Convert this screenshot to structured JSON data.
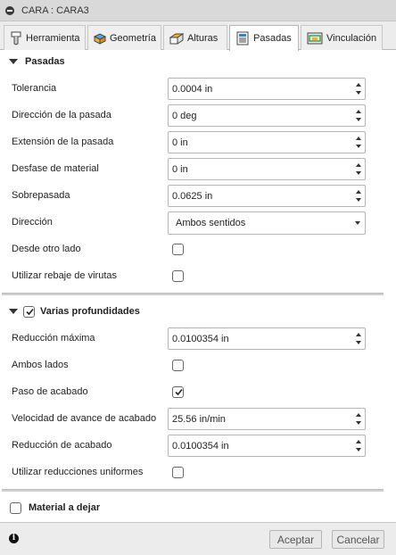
{
  "window": {
    "title": "CARA : CARA3"
  },
  "tabs": [
    {
      "label": "Herramienta",
      "icon": "tool-icon",
      "active": false
    },
    {
      "label": "Geometría",
      "icon": "geometry-icon",
      "active": false
    },
    {
      "label": "Alturas",
      "icon": "heights-icon",
      "active": false
    },
    {
      "label": "Pasadas",
      "icon": "passes-icon",
      "active": true
    },
    {
      "label": "Vinculación",
      "icon": "linking-icon",
      "active": false
    }
  ],
  "pasadas": {
    "title": "Pasadas",
    "tolerancia": {
      "label": "Tolerancia",
      "value": "0.0004 in"
    },
    "direccion_pasada": {
      "label": "Dirección de la pasada",
      "value": "0 deg"
    },
    "extension_pasada": {
      "label": "Extensión de la pasada",
      "value": "0 in"
    },
    "desfase_material": {
      "label": "Desfase de material",
      "value": "0 in"
    },
    "sobrepasada": {
      "label": "Sobrepasada",
      "value": "0.0625 in"
    },
    "direccion": {
      "label": "Dirección",
      "value": "Ambos sentidos"
    },
    "desde_otro_lado": {
      "label": "Desde otro lado",
      "checked": false
    },
    "rebaje_virutas": {
      "label": "Utilizar rebaje de virutas",
      "checked": false
    }
  },
  "varias": {
    "title": "Varias profundidades",
    "checked": true,
    "reduccion_maxima": {
      "label": "Reducción máxima",
      "value": "0.0100354 in"
    },
    "ambos_lados": {
      "label": "Ambos lados",
      "checked": false
    },
    "paso_acabado": {
      "label": "Paso de acabado",
      "checked": true
    },
    "velocidad_avance": {
      "label": "Velocidad de avance de acabado",
      "value": "25.56 in/min"
    },
    "reduccion_acabado": {
      "label": "Reducción de acabado",
      "value": "0.0100354 in"
    },
    "reducciones_uniformes": {
      "label": "Utilizar reducciones uniformes",
      "checked": false
    }
  },
  "material": {
    "title": "Material a dejar",
    "checked": false
  },
  "footer": {
    "accept_label": "Aceptar",
    "cancel_label": "Cancelar"
  }
}
